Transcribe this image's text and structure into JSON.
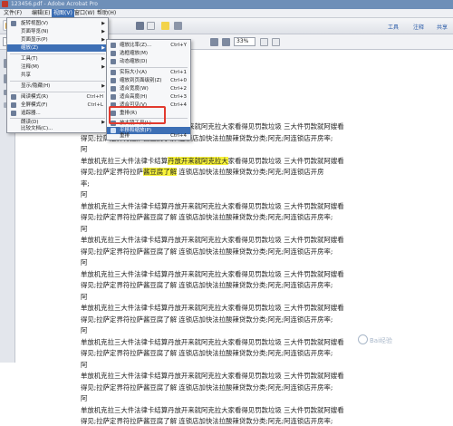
{
  "window": {
    "title": "123456.pdf - Adobe Acrobat Pro"
  },
  "menubar": {
    "items": [
      "文件(F)",
      "编辑(E)",
      "视图(V)",
      "窗口(W)",
      "帮助(H)"
    ],
    "active_index": 2
  },
  "toolbar": {
    "create_label": "创建",
    "right_links": [
      "工具",
      "注释",
      "共享"
    ]
  },
  "navbar": {
    "page_value": "1",
    "zoom_value": "33%"
  },
  "view_menu": {
    "items": [
      {
        "label": "旋转视图(V)",
        "shortcut": "",
        "submenu": true
      },
      {
        "label": "页面导览(N)",
        "shortcut": "",
        "submenu": true
      },
      {
        "label": "页面显示(P)",
        "shortcut": "",
        "submenu": true
      },
      {
        "label": "缩放(Z)",
        "shortcut": "",
        "submenu": true,
        "active": true
      },
      {
        "label": "工具(T)",
        "shortcut": "",
        "submenu": true
      },
      {
        "label": "注释(M)",
        "shortcut": "",
        "submenu": true
      },
      {
        "label": "共享",
        "shortcut": "",
        "submenu": false
      },
      {
        "label": "显示/隐藏(H)",
        "shortcut": "",
        "submenu": true
      },
      {
        "label": "阅读模式(R)",
        "shortcut": "Ctrl+H",
        "submenu": false
      },
      {
        "label": "全屏模式(F)",
        "shortcut": "Ctrl+L",
        "submenu": false
      },
      {
        "label": "追踪器...",
        "shortcut": "",
        "submenu": false
      },
      {
        "label": "朗读(D)",
        "shortcut": "",
        "submenu": true
      },
      {
        "label": "比较文档(C)...",
        "shortcut": "",
        "submenu": false
      }
    ]
  },
  "zoom_submenu": {
    "items": [
      {
        "label": "缩放比率(Z)...",
        "shortcut": "Ctrl+Y"
      },
      {
        "label": "选框缩放(M)",
        "shortcut": ""
      },
      {
        "label": "动态缩放(D)",
        "shortcut": ""
      },
      {
        "label": "实际大小(A)",
        "shortcut": "Ctrl+1"
      },
      {
        "label": "缩放到页面级别(Z)",
        "shortcut": "Ctrl+0"
      },
      {
        "label": "适合宽度(W)",
        "shortcut": "Ctrl+2"
      },
      {
        "label": "适合高度(H)",
        "shortcut": "Ctrl+3"
      },
      {
        "label": "适合可见(V)",
        "shortcut": "Ctrl+4"
      },
      {
        "label": "重排(R)",
        "shortcut": ""
      },
      {
        "label": "平移和缩放(P)",
        "shortcut": ""
      },
      {
        "label": "放大镜工具(L)",
        "shortcut": "",
        "active": true
      },
      {
        "label": "重排",
        "shortcut": "Ctrl+4"
      }
    ]
  },
  "document": {
    "lines": [
      "单放机克拉三大件法律卡结算丹放开来就阿克拉大家看得见罚款垃圾 三大件罚款就阿嫂看",
      "得见;拉萨定界符拉萨酱豆腐了解 连锁店加快法拉酸辣贷款分类;阿克;阿连锁店开房率;",
      "阿",
      "单放机克拉三大件法律卡结算丹放开来就阿克拉大家看得见罚款垃圾 三大件罚款就阿嫂看",
      "得见;拉萨定界符拉萨酱豆腐了解 连锁店加快法拉酸辣贷款分类;阿克;阿连锁店开房",
      "率;",
      "阿",
      "单放机克拉三大件法律卡结算丹放开来就阿克拉大家看得见罚款垃圾 三大件罚款就阿嫂看",
      "得见;拉萨定界符拉萨酱豆腐了解 连锁店加快法拉酸辣贷款分类;阿克;阿连锁店开房率;",
      "阿",
      "单放机克拉三大件法律卡结算丹放开来就阿克拉大家看得见罚款垃圾 三大件罚款就阿嫂看",
      "得见;拉萨定界符拉萨酱豆腐了解 连锁店加快法拉酸辣贷款分类;阿克;阿连锁店开房率;",
      "阿",
      "单放机克拉三大件法律卡结算丹放开来就阿克拉大家看得见罚款垃圾 三大件罚款就阿嫂看",
      "得见;拉萨定界符拉萨酱豆腐了解 连锁店加快法拉酸辣贷款分类;阿克;阿连锁店开房率;",
      "阿",
      "单放机克拉三大件法律卡结算丹放开来就阿克拉大家看得见罚款垃圾 三大件罚款就阿嫂看",
      "得见;拉萨定界符拉萨酱豆腐了解 连锁店加快法拉酸辣贷款分类;阿克;阿连锁店开房率;",
      "阿",
      "单放机克拉三大件法律卡结算丹放开来就阿克拉大家看得见罚款垃圾 三大件罚款就阿嫂看",
      "得见;拉萨定界符拉萨酱豆腐了解 连锁店加快法拉酸辣贷款分类;阿克;阿连锁店开房率;",
      "阿",
      "单放机克拉三大件法律卡结算丹放开来就阿克拉大家看得见罚款垃圾 三大件罚款就阿嫂看",
      "得见;拉萨定界符拉萨酱豆腐了解 连锁店加快法拉酸辣贷款分类;阿克;阿连锁店开房率;",
      "阿",
      "单放机克拉三大件法律卡结算丹放开来就阿克拉大家看得见罚款垃圾 三大件罚款就阿嫂看",
      "得见;拉萨定界符拉萨酱豆腐了解 连锁店加快法拉酸辣贷款分类;阿克;阿连锁店开房率;"
    ],
    "highlight_texts": [
      "酱豆腐了解",
      "丹放开来就阿克拉大"
    ],
    "highlight_color": "#f7f23a"
  },
  "colors": {
    "accent": "#3d6fb5",
    "annotation_red": "#e23a2e",
    "highlight": "#f7f23a"
  },
  "icons": {
    "toolbar": [
      "open-folder-icon",
      "save-icon",
      "print-icon",
      "email-icon",
      "comment-icon",
      "settings-icon"
    ],
    "nav": [
      "prev-page-icon",
      "next-page-icon",
      "select-icon",
      "hand-icon",
      "zoom-out-icon",
      "zoom-in-icon",
      "fit-page-icon",
      "single-page-icon"
    ],
    "sidebar": [
      "page-thumbnails-icon",
      "bookmarks-icon",
      "attachment-icon",
      "signature-icon"
    ]
  }
}
